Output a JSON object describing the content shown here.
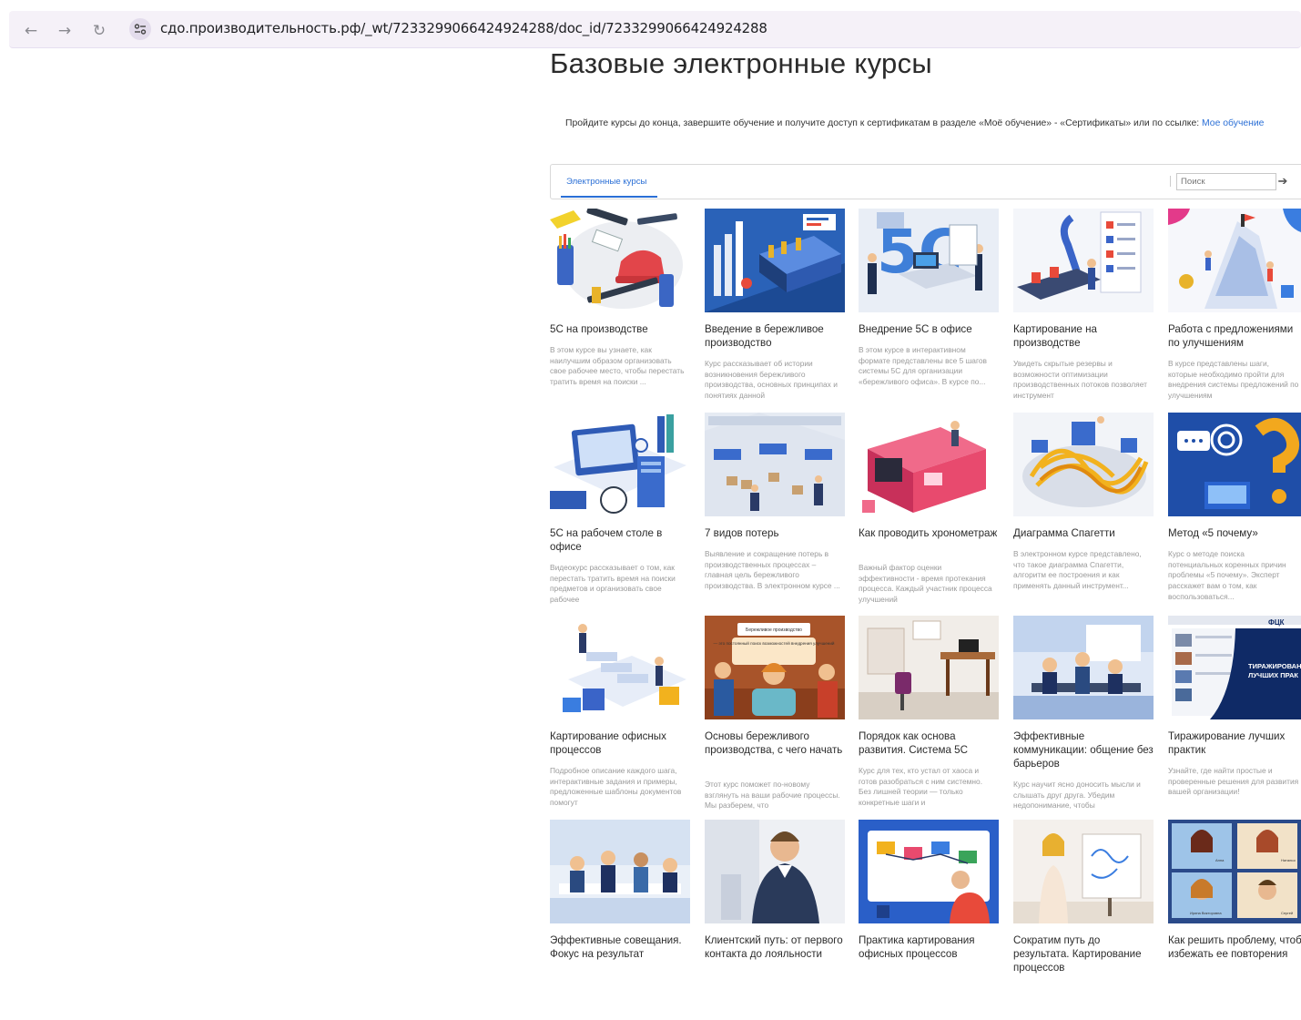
{
  "browser": {
    "url": "сдо.производительность.рф/_wt/7233299066424924288/doc_id/7233299066424924288"
  },
  "page": {
    "title": "Базовые электронные курсы",
    "intro_text": "Пройдите курсы до конца, завершите обучение и получите доступ к сертификатам в разделе «Моё обучение» - «Сертификаты» или по ссылке: ",
    "intro_link": "Мое обучение",
    "tab_label": "Электронные курсы",
    "search_placeholder": "Поиск"
  },
  "courses": [
    {
      "title": "5С на производстве",
      "description": "В этом курсе вы узнаете, как наилучшим образом организовать свое рабочее место, чтобы перестать тратить время на поиски ..."
    },
    {
      "title": "Введение в бережливое производство",
      "description": "Курс рассказывает об истории возникновения бережливого производства, основных принципах и понятиях данной"
    },
    {
      "title": "Внедрение 5С в офисе",
      "description": "В этом курсе в интерактивном формате представлены все 5 шагов системы 5С для организации «бережливого офиса». В курсе по..."
    },
    {
      "title": "Картирование на производстве",
      "description": "Увидеть скрытые резервы и возможности оптимизации производственных потоков позволяет инструмент"
    },
    {
      "title": "Работа с предложениями по улучшениям",
      "description": "В курсе представлены шаги, которые необходимо пройти для внедрения системы предложений по улучшениям"
    },
    {
      "title": "5С на рабочем столе в офисе",
      "description": "Видеокурс рассказывает о том, как перестать тратить время на поиски предметов и организовать свое рабочее"
    },
    {
      "title": "7 видов потерь",
      "description": "Выявление и сокращение потерь в производственных процессах – главная цель бережливого производства. В электронном курсе ..."
    },
    {
      "title": "Как проводить хронометраж",
      "description": "Важный фактор оценки эффективности - время протекания процесса. Каждый участник процесса улучшений"
    },
    {
      "title": "Диаграмма Спагетти",
      "description": "В электронном курсе представлено, что такое диаграмма Спагетти, алгоритм ее построения и как применять данный инструмент..."
    },
    {
      "title": "Метод «5 почему»",
      "description": "Курс о методе поиска потенциальных коренных причин проблемы «5 почему». Эксперт расскажет вам о том, как воспользоваться..."
    },
    {
      "title": "Картирование офисных процессов",
      "description": "Подробное описание каждого шага, интерактивные задания и примеры, предложенные шаблоны документов помогут"
    },
    {
      "title": "Основы бережливого производства, с чего начать",
      "description": "Этот курс поможет по-новому взглянуть на ваши рабочие процессы. Мы разберем, что"
    },
    {
      "title": "Порядок как основа развития. Система 5С",
      "description": "Курс для тех, кто устал от хаоса и готов разобраться с ним системно. Без лишней теории — только конкретные шаги и"
    },
    {
      "title": "Эффективные коммуникации: общение без барьеров",
      "description": "Курс научит ясно доносить мысли и слышать друг друга. Убедим недопонимание, чтобы"
    },
    {
      "title": "Тиражирование лучших практик",
      "description": "Узнайте, где найти простые и проверенные решения для развития вашей организации!"
    },
    {
      "title": "Эффективные совещания. Фокус на результат",
      "description": ""
    },
    {
      "title": "Клиентский путь: от первого контакта до лояльности",
      "description": ""
    },
    {
      "title": "Практика картирования офисных процессов",
      "description": ""
    },
    {
      "title": "Сократим путь до результата. Картирование процессов",
      "description": ""
    },
    {
      "title": "Как решить проблему, чтобы избежать ее повторения",
      "description": ""
    }
  ],
  "thumb_texts": {
    "t12_bubble1": "Бережливое производство",
    "t12_bubble2": "— это постоянный поиск возможностей внедрения улучшений",
    "t15_logo": "ФЦК",
    "t15_line1": "ТИРАЖИРОВАН",
    "t15_line2": "ЛУЧШИХ ПРАК",
    "t20_name1": "Анна",
    "t20_name2": "Наталья",
    "t20_name3": "Ирина Викторовна",
    "t20_name4": "Сергей"
  }
}
